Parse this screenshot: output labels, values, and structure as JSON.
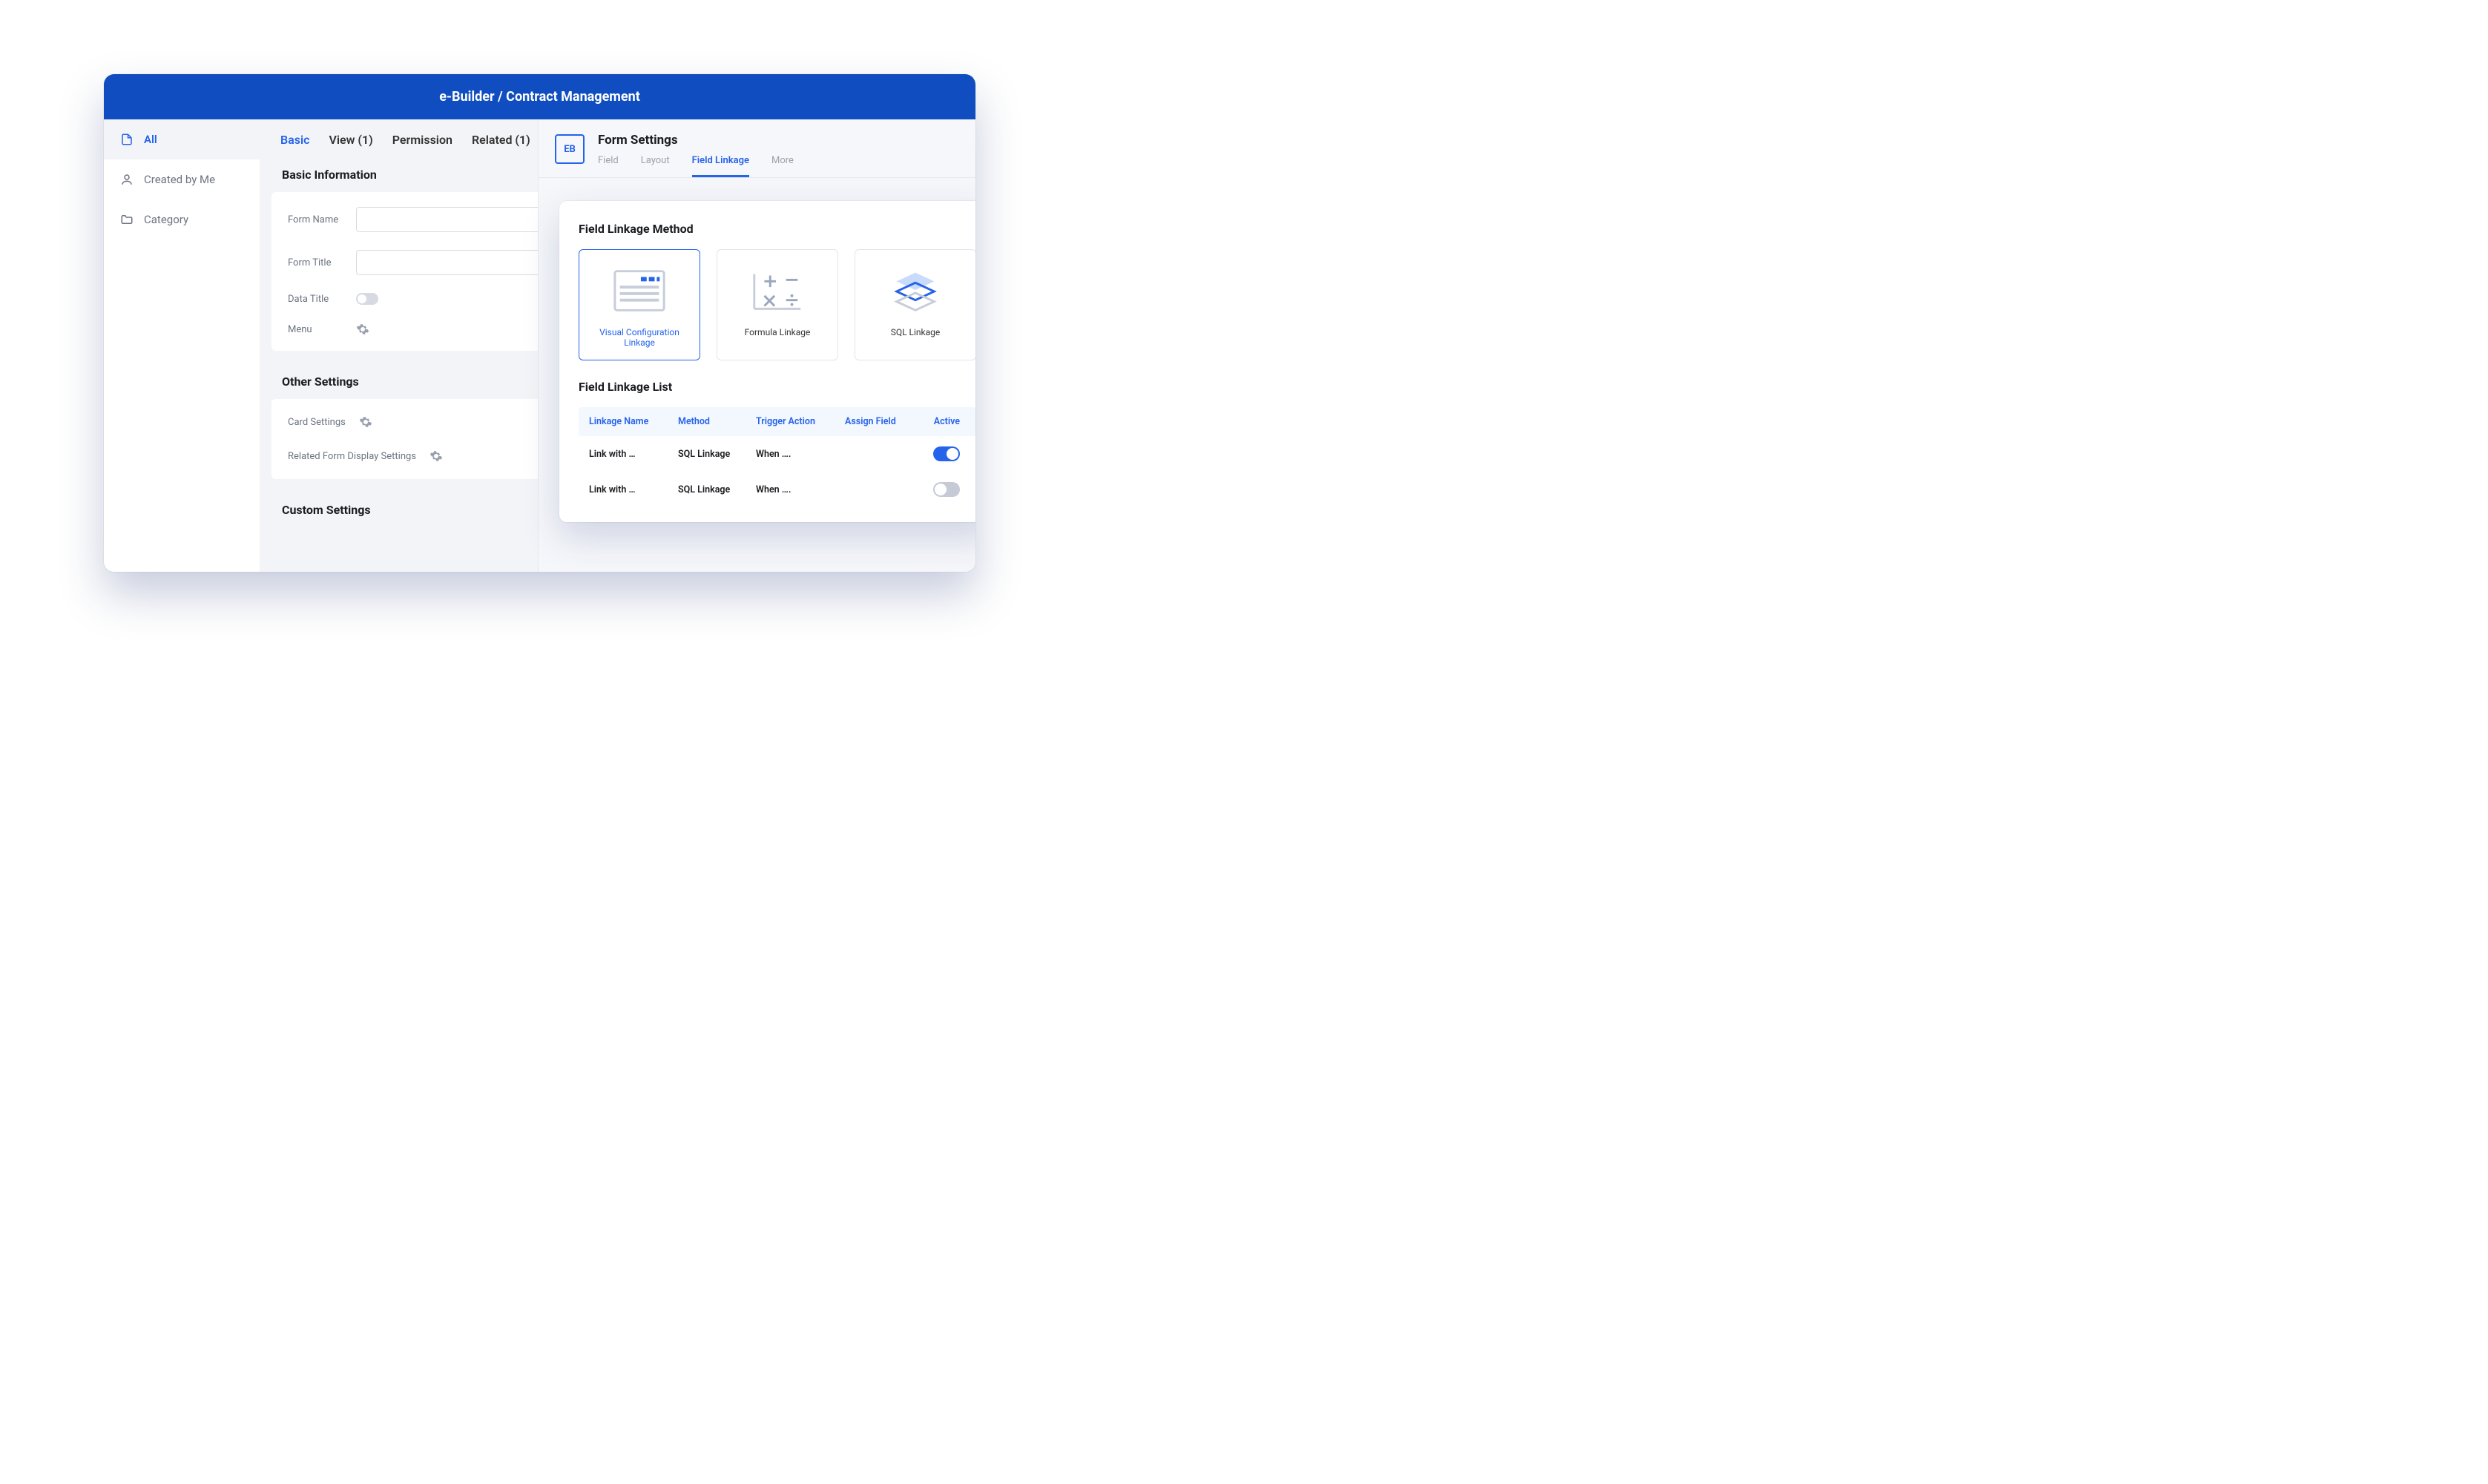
{
  "titlebar": "e-Builder / Contract Management",
  "sidebar": {
    "items": [
      {
        "label": "All",
        "icon": "file"
      },
      {
        "label": "Created by Me",
        "icon": "user"
      },
      {
        "label": "Category",
        "icon": "folder"
      }
    ]
  },
  "tabs": {
    "items": [
      "Basic",
      "View (1)",
      "Permission",
      "Related (1)"
    ]
  },
  "section_basic": {
    "title": "Basic Information",
    "form_name_label": "Form Name",
    "form_title_label": "Form Title",
    "data_title_label": "Data Title",
    "menu_label": "Menu"
  },
  "section_other": {
    "title": "Other Settings",
    "card_settings": "Card Settings",
    "related_display": "Related Form Display Settings"
  },
  "section_custom": {
    "title": "Custom Settings"
  },
  "form_settings": {
    "badge": "EB",
    "title": "Form Settings",
    "tabs": [
      "Field",
      "Layout",
      "Field Linkage",
      "More"
    ]
  },
  "popup": {
    "method_title": "Field Linkage Method",
    "cards": [
      {
        "label": "Visual Configuration Linkage"
      },
      {
        "label": "Formula Linkage"
      },
      {
        "label": "SQL Linkage"
      }
    ],
    "list_title": "Field Linkage List",
    "columns": {
      "name": "Linkage Name",
      "method": "Method",
      "trigger": "Trigger Action",
      "assign": "Assign Field",
      "active": "Active"
    },
    "rows": [
      {
        "name": "Link with …",
        "method": "SQL Linkage",
        "trigger": "When ….",
        "assign": "",
        "active": true
      },
      {
        "name": "Link with …",
        "method": "SQL Linkage",
        "trigger": "When ….",
        "assign": "",
        "active": false
      }
    ]
  }
}
